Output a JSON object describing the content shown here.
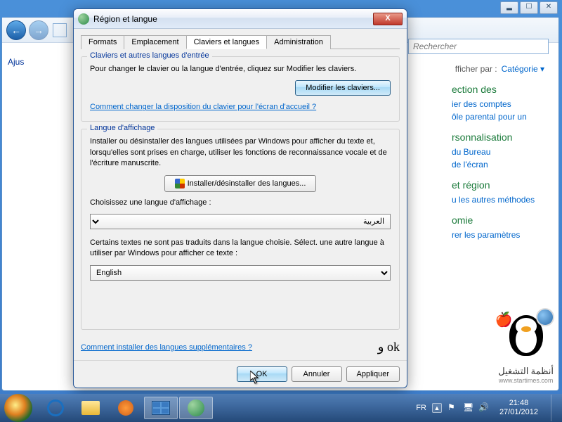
{
  "top_controls": {
    "min": "▂",
    "max": "☐",
    "close": "✕"
  },
  "bg": {
    "search_placeholder": "Rechercher",
    "left_label": "Ajus",
    "filter_label": "fficher par :",
    "filter_value": "Catégorie ▾",
    "categories": [
      {
        "head": "ection des",
        "links": [
          "ier des comptes",
          "ôle parental pour un"
        ]
      },
      {
        "head": "rsonnalisation",
        "links": [
          "du Bureau",
          "de l'écran"
        ]
      },
      {
        "head": "et région",
        "links": [
          "u les autres méthodes"
        ]
      },
      {
        "head": "omie",
        "links": [
          "rer les paramètres"
        ]
      }
    ]
  },
  "dialog": {
    "title": "Région et langue",
    "close": "X",
    "tabs": [
      "Formats",
      "Emplacement",
      "Claviers et langues",
      "Administration"
    ],
    "active_tab": 2,
    "group1": {
      "title": "Claviers et autres langues d'entrée",
      "text": "Pour changer le clavier ou la langue d'entrée, cliquez sur Modifier les claviers.",
      "button": "Modifier les claviers...",
      "link": "Comment changer la disposition du clavier pour l'écran d'accueil ?"
    },
    "group2": {
      "title": "Langue d'affichage",
      "text": "Installer ou désinstaller des langues utilisées par Windows pour afficher du texte et, lorsqu'elles sont prises en charge, utiliser les fonctions de reconnaissance vocale et de l'écriture manuscrite.",
      "install_btn": "Installer/désinstaller des langues...",
      "choose_label": "Choisissez une langue d'affichage :",
      "lang1": "العربية",
      "fallback_text": "Certains textes ne sont pas traduits dans la langue choisie. Sélect. une autre langue à utiliser par Windows pour afficher ce texte :",
      "lang2": "English"
    },
    "bottom_link": "Comment installer des langues supplémentaires ?",
    "annotation": "و ok",
    "buttons": {
      "ok": "OK",
      "cancel": "Annuler",
      "apply": "Appliquer"
    }
  },
  "taskbar": {
    "lang": "FR",
    "time": "21:48",
    "date": "27/01/2012"
  },
  "watermark": {
    "text": "أنظمة التشغيل",
    "url": "www.startimes.com"
  }
}
